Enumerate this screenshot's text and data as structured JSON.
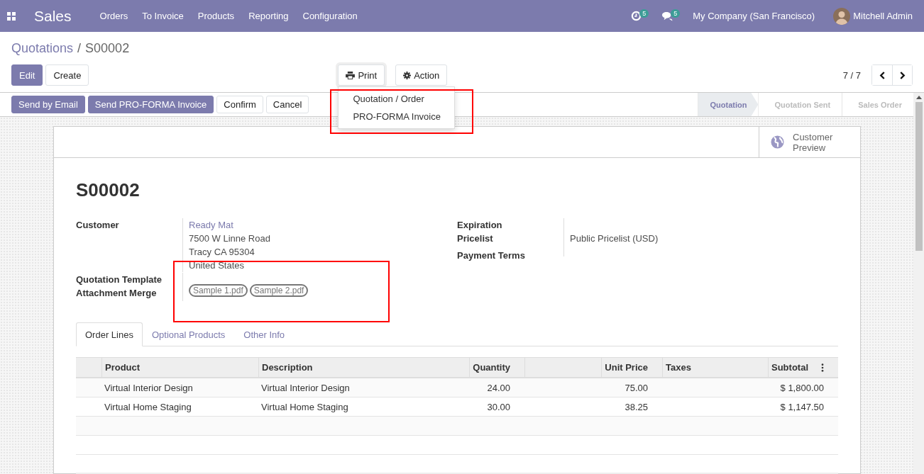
{
  "navbar": {
    "app_name": "Sales",
    "menu": [
      "Orders",
      "To Invoice",
      "Products",
      "Reporting",
      "Configuration"
    ],
    "activity_count": "5",
    "message_count": "5",
    "company": "My Company (San Francisco)",
    "user": "Mitchell Admin"
  },
  "breadcrumb": {
    "parent": "Quotations",
    "separator": "/",
    "current": "S00002"
  },
  "main_buttons": [
    {
      "label": "Edit",
      "kind": "primary"
    },
    {
      "label": "Create",
      "kind": "secondary"
    }
  ],
  "print": {
    "label": "Print",
    "expanded": true,
    "items": [
      "Quotation / Order",
      "PRO-FORMA Invoice"
    ]
  },
  "action": {
    "label": "Action"
  },
  "pager": "7 / 7",
  "header_buttons": [
    {
      "label": "Send by Email",
      "kind": "primary"
    },
    {
      "label": "Send PRO-FORMA Invoice",
      "kind": "primary"
    },
    {
      "label": "Confirm",
      "kind": "secondary"
    },
    {
      "label": "Cancel",
      "kind": "secondary"
    }
  ],
  "statusbar": [
    {
      "label": "Quotation",
      "selected": true
    },
    {
      "label": "Quotation Sent",
      "selected": false
    },
    {
      "label": "Sales Order",
      "selected": false
    }
  ],
  "smart_button": {
    "label": "Customer Preview"
  },
  "title": "S00002",
  "customer": {
    "label": "Customer",
    "name": "Ready Mat",
    "address": [
      "7500 W Linne Road",
      "Tracy CA 95304",
      "United States"
    ]
  },
  "template_label": "Quotation Template",
  "attachment_merge": {
    "label": "Attachment Merge",
    "tags": [
      "Sample  1.pdf",
      "Sample  2.pdf"
    ]
  },
  "right_fields": [
    {
      "label": "Expiration"
    },
    {
      "label": "Pricelist",
      "value": "Public Pricelist (USD)"
    },
    {
      "label": "Payment Terms"
    }
  ],
  "tabs": [
    {
      "label": "Order Lines",
      "selected": true
    },
    {
      "label": "Optional Products",
      "selected": false
    },
    {
      "label": "Other Info",
      "selected": false
    }
  ],
  "table": {
    "columns": [
      {
        "label": "Product"
      },
      {
        "label": "Description"
      },
      {
        "label": "Quantity"
      },
      {
        "label": "Unit Price"
      },
      {
        "label": "Taxes"
      },
      {
        "label": "Subtotal"
      }
    ],
    "rows": [
      {
        "product": "Virtual Interior Design",
        "description": "Virtual Interior Design",
        "quantity": "24.00",
        "unit_price": "75.00",
        "subtotal": "$ 1,800.00"
      },
      {
        "product": "Virtual Home Staging",
        "description": "Virtual Home Staging",
        "quantity": "30.00",
        "unit_price": "38.25",
        "subtotal": "$ 1,147.50"
      }
    ]
  }
}
